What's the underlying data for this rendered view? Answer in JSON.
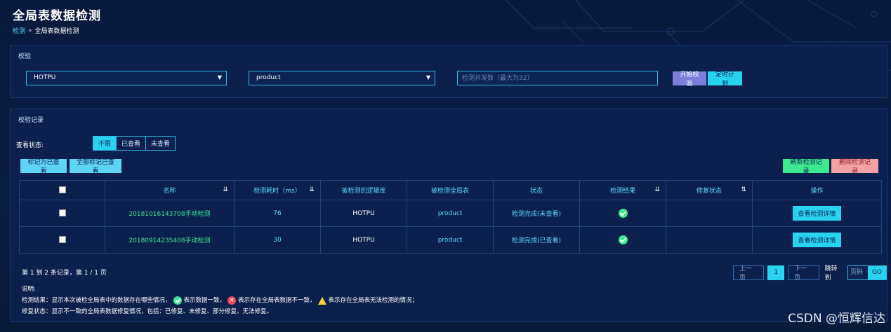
{
  "page": {
    "title": "全局表数据检测",
    "breadcrumb": {
      "root": "检测",
      "separator": "»",
      "current": "全局表数据检测"
    }
  },
  "verify": {
    "panel_title": "校验",
    "schema_select": {
      "value": "HOTPU"
    },
    "table_select": {
      "value": "product"
    },
    "concurrency_input": {
      "value": "",
      "placeholder": "检测并发数（最大为32）"
    },
    "start_button": "开始校验",
    "schedule_button": "定时计划"
  },
  "records": {
    "panel_title": "校验记录",
    "filter": {
      "label": "查看状态:",
      "options": [
        "不限",
        "已查看",
        "未查看"
      ],
      "active_index": 0
    },
    "buttons": {
      "mark_viewed": "标记为已查看",
      "mark_all_viewed": "全部标记已查看",
      "refresh": "刷新检测记录",
      "delete": "删除检测记录"
    },
    "table": {
      "columns": [
        "名称",
        "检测耗时（ms）",
        "被检测的逻辑库",
        "被检测全局表",
        "状态",
        "检测结果",
        "修复状态",
        "操作"
      ],
      "rows": [
        {
          "name": "20181016143708手动检测",
          "duration": "76",
          "schema": "HOTPU",
          "table": "product",
          "status": "检测完成(未查看)",
          "result": "ok",
          "repair": "",
          "action": "查看检测详情"
        },
        {
          "name": "20180914235408手动检测",
          "duration": "30",
          "schema": "HOTPU",
          "table": "product",
          "status": "检测完成(已查看)",
          "result": "ok",
          "repair": "",
          "action": "查看检测详情"
        }
      ]
    },
    "summary": "第 1 到 2 条记录，第 1 / 1 页",
    "pager": {
      "prev": "上一页",
      "current": "1",
      "next": "下一页",
      "jump_label": "跳转到",
      "page_placeholder": "页码",
      "go": "GO"
    },
    "notes": {
      "title": "说明:",
      "result_prefix": "检测结果：显示本次被检全局表中的数据存在哪些情况，",
      "ok_text": "表示数据一致，",
      "err_text": "表示存在全局表数据不一致，",
      "warn_text": "表示存在全局表无法检测的情况；",
      "repair_line": "修复状态：显示不一致的全局表数据修复情况，包括：已修复、未修复、部分修复、无法修复。"
    }
  },
  "watermark": "CSDN @恒辉信达",
  "colors": {
    "accent": "#27d3ee",
    "ok": "#3ee88f",
    "error": "#ef4a58",
    "warning": "#f3d23a",
    "background": "#0a1a3e"
  }
}
